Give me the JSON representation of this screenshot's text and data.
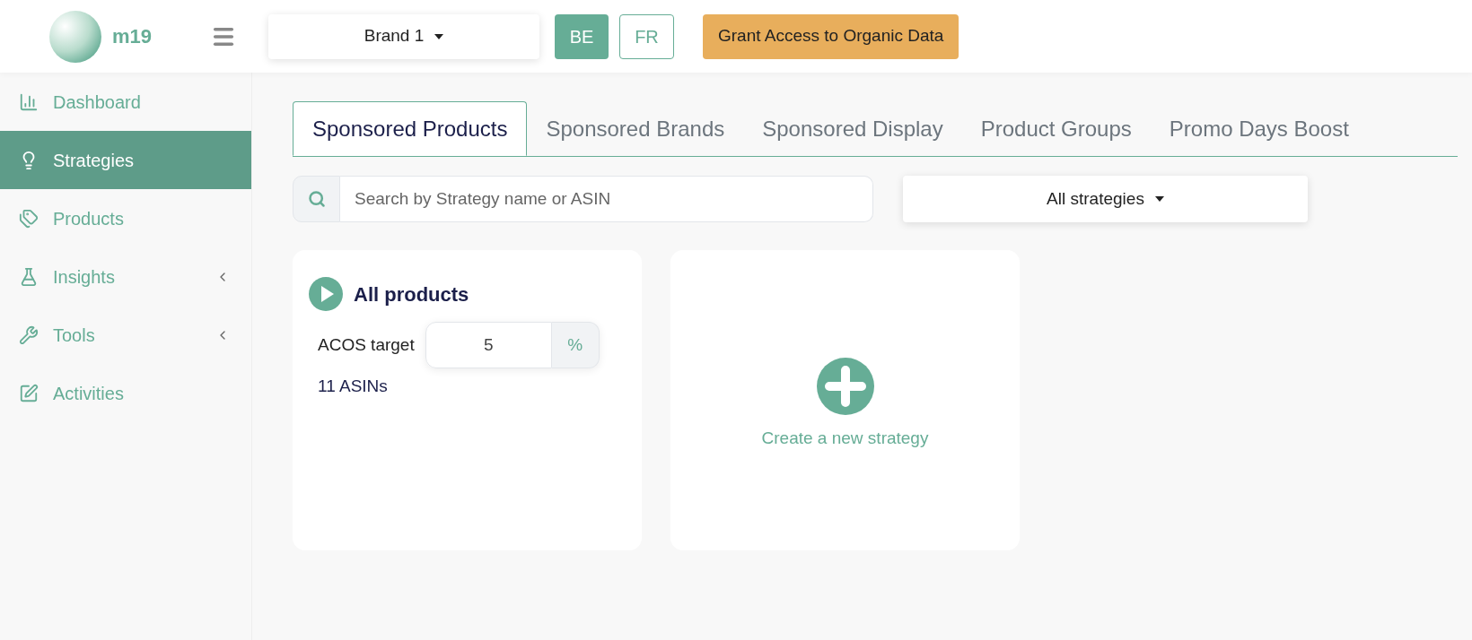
{
  "header": {
    "logo_text": "m19",
    "brand_select": "Brand 1",
    "markets": [
      {
        "label": "BE",
        "selected": true
      },
      {
        "label": "FR",
        "selected": false
      }
    ],
    "grant_button": "Grant Access to Organic Data"
  },
  "sidebar": {
    "items": [
      {
        "label": "Dashboard",
        "selected": false,
        "expandable": false
      },
      {
        "label": "Strategies",
        "selected": true,
        "expandable": false
      },
      {
        "label": "Products",
        "selected": false,
        "expandable": false
      },
      {
        "label": "Insights",
        "selected": false,
        "expandable": true
      },
      {
        "label": "Tools",
        "selected": false,
        "expandable": true
      },
      {
        "label": "Activities",
        "selected": false,
        "expandable": false
      }
    ]
  },
  "tabs": [
    {
      "label": "Sponsored Products",
      "selected": true
    },
    {
      "label": "Sponsored Brands",
      "selected": false
    },
    {
      "label": "Sponsored Display",
      "selected": false
    },
    {
      "label": "Product Groups",
      "selected": false
    },
    {
      "label": "Promo Days Boost",
      "selected": false
    }
  ],
  "search": {
    "placeholder": "Search by Strategy name or ASIN"
  },
  "filter_select": "All strategies",
  "strategies": [
    {
      "name": "All products",
      "acos_label": "ACOS target",
      "acos_value": "5",
      "acos_unit": "%",
      "asins": "11 ASINs"
    }
  ],
  "new_strategy": "Create a new strategy"
}
